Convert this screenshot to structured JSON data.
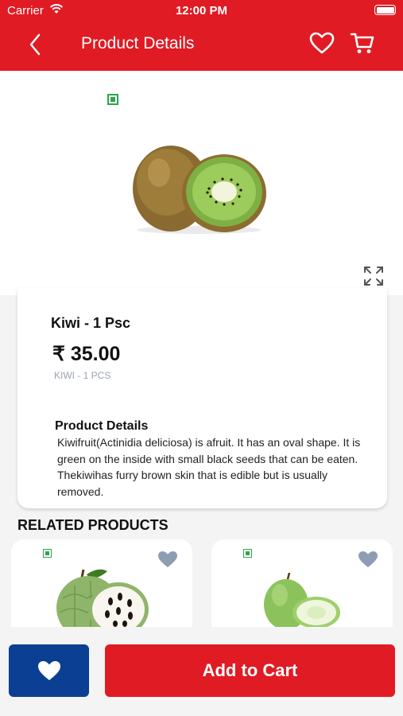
{
  "status_bar": {
    "carrier": "Carrier",
    "time": "12:00 PM"
  },
  "header": {
    "title": "Product Details"
  },
  "product": {
    "name": "Kiwi - 1 Psc",
    "price": "₹ 35.00",
    "sku": "KIWI - 1 PCS",
    "details_heading": "Product Details",
    "description": "Kiwifruit(Actinidia deliciosa) is afruit. It has an oval shape. It is green on the inside with small black seeds that can be eaten. Thekiwihas furry brown skin that is edible but is usually removed."
  },
  "related": {
    "heading": "RELATED PRODUCTS"
  },
  "actions": {
    "add_to_cart": "Add to Cart"
  },
  "colors": {
    "brand_red": "#e01b24",
    "navy": "#0b3f93",
    "veg_green": "#2ea44f"
  }
}
